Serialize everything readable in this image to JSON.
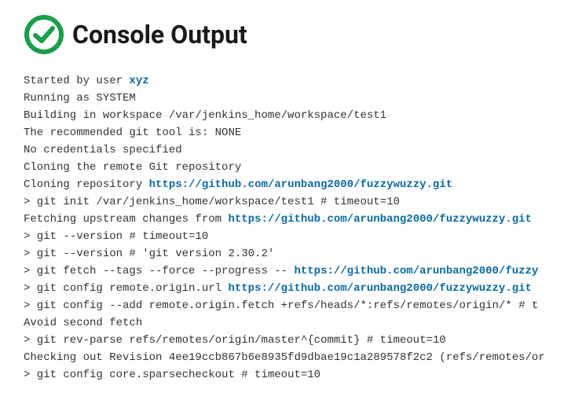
{
  "header": {
    "title": "Console Output",
    "icon": "success-check-icon",
    "icon_color": "#1b9e4b"
  },
  "user": {
    "label": "xyz",
    "url": "#"
  },
  "repo": {
    "url": "https://github.com/arunbang2000/fuzzywuzzy.git",
    "url_truncated": "https://github.com/arunbang2000/fuzzy"
  },
  "log": {
    "l01a": "Started by user ",
    "l02": "Running as SYSTEM",
    "l03": "Building in workspace /var/jenkins_home/workspace/test1",
    "l04": "The recommended git tool is: NONE",
    "l05": "No credentials specified",
    "l06": "Cloning the remote Git repository",
    "l07a": "Cloning repository ",
    "l08": " > git init /var/jenkins_home/workspace/test1 # timeout=10",
    "l09a": "Fetching upstream changes from ",
    "l10": " > git --version # timeout=10",
    "l11": " > git --version # 'git version 2.30.2'",
    "l12a": " > git fetch --tags --force --progress -- ",
    "l13a": " > git config remote.origin.url ",
    "l14": " > git config --add remote.origin.fetch +refs/heads/*:refs/remotes/origin/* # t",
    "l15": "Avoid second fetch",
    "l16": " > git rev-parse refs/remotes/origin/master^{commit} # timeout=10",
    "l17": "Checking out Revision 4ee19ccb867b6e8935fd9dbae19c1a289578f2c2 (refs/remotes/or",
    "l18": " > git config core.sparsecheckout # timeout=10"
  }
}
